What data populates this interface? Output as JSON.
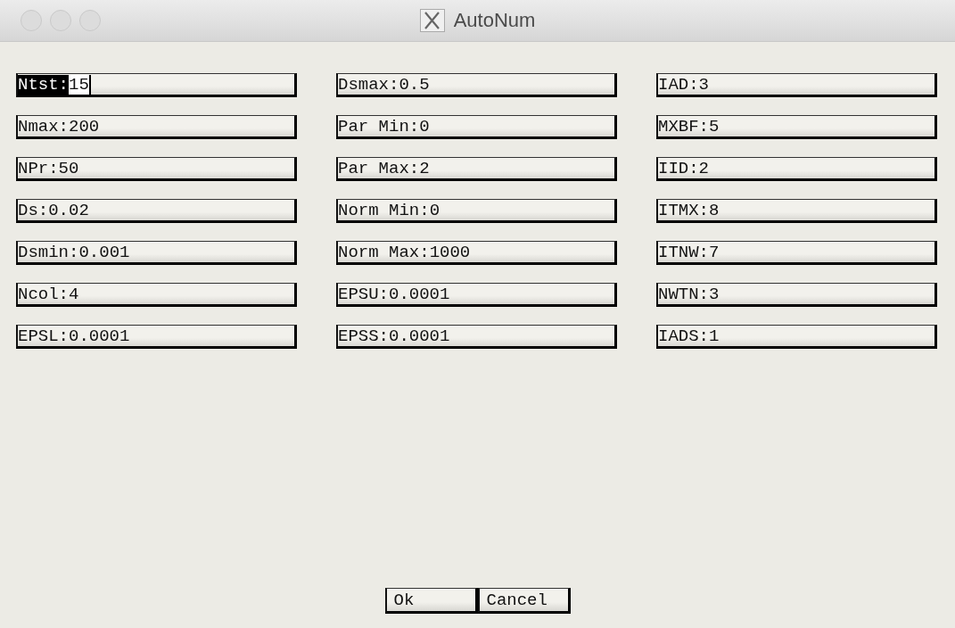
{
  "window": {
    "title": "AutoNum"
  },
  "columns": [
    {
      "fields": [
        {
          "label": "Ntst:",
          "value": "15",
          "selected": true
        },
        {
          "label": "Nmax:",
          "value": "200",
          "selected": false
        },
        {
          "label": "NPr:",
          "value": "50",
          "selected": false
        },
        {
          "label": "Ds:",
          "value": "0.02",
          "selected": false
        },
        {
          "label": "Dsmin:",
          "value": "0.001",
          "selected": false
        },
        {
          "label": "Ncol:",
          "value": "4",
          "selected": false
        },
        {
          "label": "EPSL:",
          "value": "0.0001",
          "selected": false
        }
      ]
    },
    {
      "fields": [
        {
          "label": "Dsmax:",
          "value": "0.5",
          "selected": false
        },
        {
          "label": "Par Min:",
          "value": "0",
          "selected": false
        },
        {
          "label": "Par Max:",
          "value": "2",
          "selected": false
        },
        {
          "label": "Norm Min:",
          "value": "0",
          "selected": false
        },
        {
          "label": "Norm Max:",
          "value": "1000",
          "selected": false
        },
        {
          "label": "EPSU:",
          "value": "0.0001",
          "selected": false
        },
        {
          "label": "EPSS:",
          "value": "0.0001",
          "selected": false
        }
      ]
    },
    {
      "fields": [
        {
          "label": "IAD:",
          "value": "3",
          "selected": false
        },
        {
          "label": "MXBF:",
          "value": "5",
          "selected": false
        },
        {
          "label": "IID:",
          "value": "2",
          "selected": false
        },
        {
          "label": "ITMX:",
          "value": "8",
          "selected": false
        },
        {
          "label": "ITNW:",
          "value": "7",
          "selected": false
        },
        {
          "label": "NWTN:",
          "value": "3",
          "selected": false
        },
        {
          "label": "IADS:",
          "value": "1",
          "selected": false
        }
      ]
    }
  ],
  "buttons": [
    {
      "label": "Ok"
    },
    {
      "label": "Cancel"
    }
  ]
}
